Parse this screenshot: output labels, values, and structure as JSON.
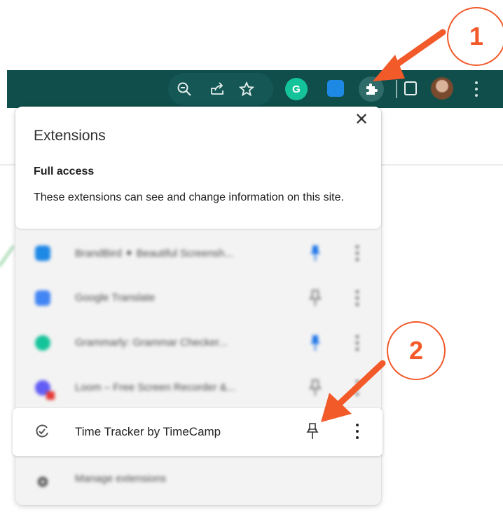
{
  "toolbar": {
    "grammarly_letter": "G",
    "icons": [
      "zoom-out-icon",
      "share-icon",
      "bookmark-star-icon",
      "grammarly-icon",
      "brandbird-icon",
      "extensions-puzzle-icon",
      "side-panel-icon",
      "profile-avatar",
      "chrome-menu-icon"
    ]
  },
  "popup": {
    "title": "Extensions",
    "close_symbol": "✕",
    "access_heading": "Full access",
    "access_description": "These extensions can see and change information on this site."
  },
  "extensions": [
    {
      "name": "BrandBird ✦ Beautiful Screensh...",
      "pinned": true,
      "icon_color": "#1e88e5"
    },
    {
      "name": "Google Translate",
      "pinned": false,
      "icon_color": "#4285f4"
    },
    {
      "name": "Grammarly: Grammar Checker...",
      "pinned": true,
      "icon_color": "#15c39a"
    },
    {
      "name": "Loom – Free Screen Recorder &...",
      "pinned": false,
      "icon_color": "#625df5"
    }
  ],
  "highlighted_extension": {
    "name": "Time Tracker by TimeCamp",
    "pinned": false
  },
  "manage": {
    "label": "Manage extensions"
  },
  "annotations": {
    "one": "1",
    "two": "2",
    "color": "#f25a2a"
  }
}
